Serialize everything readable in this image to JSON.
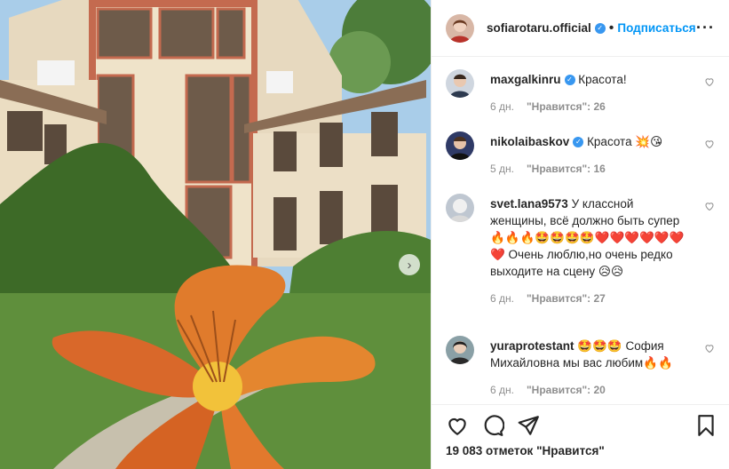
{
  "post": {
    "author": "sofiarotaru.official",
    "dot": "•",
    "follow_label": "Подписаться",
    "more_icon": "more-options-icon",
    "carousel_next": "›"
  },
  "comments": [
    {
      "user": "maxgalkinru",
      "verified": true,
      "text": "Красота!",
      "age": "6 дн.",
      "likes": "\"Нравится\": 26"
    },
    {
      "user": "nikolaibaskov",
      "verified": true,
      "text": "Красота 💥😘",
      "age": "5 дн.",
      "likes": "\"Нравится\": 16"
    },
    {
      "user": "svet.lana9573",
      "verified": false,
      "text": "У классной женщины, всё должно быть супер🔥🔥🔥🤩🤩🤩🤩❤️❤️❤️❤️❤️❤️❤️ Очень люблю,но очень редко выходите на сцену 😥😥",
      "age": "6 дн.",
      "likes": "\"Нравится\": 27"
    },
    {
      "user": "yuraprotestant",
      "verified": false,
      "text": "🤩🤩🤩 София Михайловна мы вас любим🔥🔥",
      "age": "6 дн.",
      "likes": "\"Нравится\": 20"
    }
  ],
  "footer": {
    "likes_total": "19 083 отметок \"Нравится\""
  },
  "colors": {
    "accent": "#0095f6",
    "verified": "#3897f0",
    "meta": "#8e8e8e"
  }
}
